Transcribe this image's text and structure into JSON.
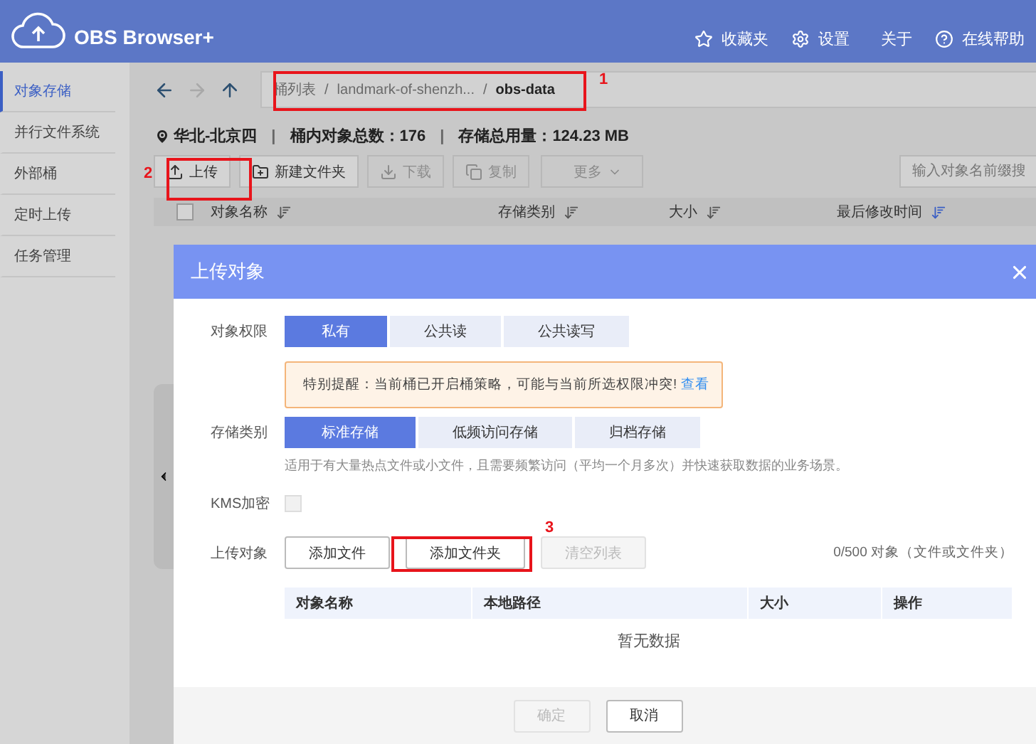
{
  "app": {
    "title": "OBS Browser+"
  },
  "header_links": [
    {
      "kind": "star",
      "label": "收藏夹"
    },
    {
      "kind": "gear",
      "label": "设置"
    },
    {
      "kind": "info",
      "label": "关于"
    },
    {
      "kind": "help",
      "label": "在线帮助"
    }
  ],
  "sidebar": {
    "items": [
      {
        "label": "对象存储",
        "selected": true
      },
      {
        "label": "并行文件系统",
        "selected": false
      },
      {
        "label": "外部桶",
        "selected": false
      },
      {
        "label": "定时上传",
        "selected": false
      },
      {
        "label": "任务管理",
        "selected": false
      }
    ]
  },
  "breadcrumb": {
    "separator": "/",
    "items": [
      {
        "label": "桶列表",
        "current": false
      },
      {
        "label": "landmark-of-shenzh...",
        "current": false
      },
      {
        "label": "obs-data",
        "current": true
      }
    ]
  },
  "bucket_info": {
    "separator": "|",
    "region": "华北-北京四",
    "object_count": "桶内对象总数：176",
    "usage": "存储总用量：124.23 MB"
  },
  "toolbar": [
    {
      "kind": "upload",
      "label": "上传",
      "disabled": false
    },
    {
      "kind": "folder",
      "label": "新建文件夹",
      "disabled": false
    },
    {
      "kind": "download",
      "label": "下载",
      "disabled": true
    },
    {
      "kind": "copy",
      "label": "复制",
      "disabled": true
    },
    {
      "kind": "more",
      "label": "更多",
      "disabled": true
    }
  ],
  "search": {
    "placeholder": "输入对象名前缀搜"
  },
  "table": {
    "select_all_checked": false,
    "columns": [
      {
        "label": "对象名称",
        "sorted": false
      },
      {
        "label": "存储类别",
        "sorted": false
      },
      {
        "label": "大小",
        "sorted": false
      },
      {
        "label": "最后修改时间",
        "sorted": true
      }
    ]
  },
  "dialog": {
    "title": "上传对象",
    "permission": {
      "label": "对象权限",
      "options": [
        {
          "label": "私有",
          "selected": true
        },
        {
          "label": "公共读",
          "selected": false
        },
        {
          "label": "公共读写",
          "selected": false
        }
      ]
    },
    "warning": {
      "text": "特别提醒：当前桶已开启桶策略，可能与当前所选权限冲突!",
      "link": "查看"
    },
    "storage_class": {
      "label": "存储类别",
      "options": [
        {
          "label": "标准存储",
          "selected": true
        },
        {
          "label": "低频访问存储",
          "selected": false
        },
        {
          "label": "归档存储",
          "selected": false
        }
      ],
      "description": "适用于有大量热点文件或小文件，且需要频繁访问（平均一个月多次）并快速获取数据的业务场景。"
    },
    "kms": {
      "label": "KMS加密",
      "checked": false
    },
    "upload": {
      "label": "上传对象",
      "buttons": [
        {
          "label": "添加文件",
          "disabled": false
        },
        {
          "label": "添加文件夹",
          "disabled": false
        },
        {
          "label": "清空列表",
          "disabled": true
        }
      ],
      "count": "0/500 对象（文件或文件夹）"
    },
    "file_table": {
      "columns": [
        "对象名称",
        "本地路径",
        "大小",
        "操作"
      ],
      "empty": "暂无数据"
    },
    "footer": [
      {
        "label": "确定",
        "disabled": true
      },
      {
        "label": "取消",
        "disabled": false
      }
    ]
  },
  "annotations": [
    {
      "label": "1"
    },
    {
      "label": "2"
    },
    {
      "label": "3"
    }
  ]
}
